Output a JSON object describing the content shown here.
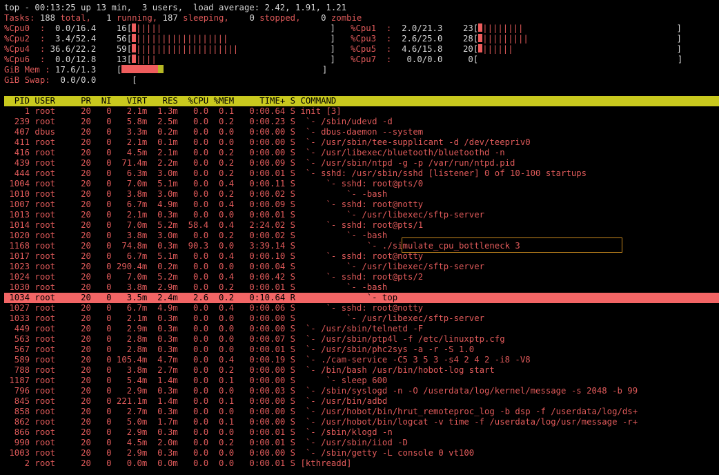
{
  "summary": {
    "line1": "top - 00:13:25 up 13 min,  3 users,  load average: 2.42, 1.91, 1.21",
    "tasks": {
      "label": "Tasks:",
      "total": "188",
      "total_word": " total,",
      "running": "1",
      "running_word": " running,",
      "sleeping": "187",
      "sleeping_word": " sleeping,",
      "stopped": "0",
      "stopped_word": " stopped,",
      "zombie": "0",
      "zombie_word": " zombie"
    }
  },
  "cpu_left": [
    {
      "label": "%Cpu0  :",
      "us_sy": "0.0/16.4",
      "pct": "16",
      "ticks": "|||||",
      "usage": 0.164
    },
    {
      "label": "%Cpu2  :",
      "us_sy": "3.4/52.4",
      "pct": "56",
      "ticks": "||||||||||||||||||",
      "usage": 0.558
    },
    {
      "label": "%Cpu4  :",
      "us_sy": "36.6/22.2",
      "pct": "59",
      "ticks": "||||||||||||||||||||",
      "usage": 0.588
    },
    {
      "label": "%Cpu6  :",
      "us_sy": "0.0/12.8",
      "pct": "13",
      "ticks": "||||",
      "usage": 0.128
    }
  ],
  "cpu_right": [
    {
      "label": "%Cpu1  :",
      "us_sy": "2.0/21.3",
      "pct": "23",
      "ticks": "||||||||",
      "usage": 0.233
    },
    {
      "label": "%Cpu3  :",
      "us_sy": "2.6/25.0",
      "pct": "28",
      "ticks": "|||||||||",
      "usage": 0.276
    },
    {
      "label": "%Cpu5  :",
      "us_sy": "4.6/15.8",
      "pct": "20",
      "ticks": "||||||",
      "usage": 0.204
    },
    {
      "label": "%Cpu7  :",
      "us_sy": "0.0/0.0",
      "pct": "0",
      "ticks": "",
      "usage": 0.0
    }
  ],
  "memory": {
    "mem_label": "GiB Mem :",
    "mem_values": "17.6/1.3",
    "mem_used_fraction": 0.105,
    "mem_buff_fraction": 0.014,
    "swap_label": "GiB Swap:",
    "swap_values": "0.0/0.0"
  },
  "columns": [
    "PID",
    "USER",
    "PR",
    "NI",
    "VIRT",
    "RES",
    "%CPU",
    "%MEM",
    "TIME+",
    "S",
    "COMMAND"
  ],
  "processes": [
    {
      "pid": "1",
      "user": "root",
      "pr": "20",
      "ni": "0",
      "virt": "2.1m",
      "res": "1.3m",
      "cpu": "0.0",
      "mem": "0.1",
      "time": "0:00.64",
      "s": "S",
      "cmd": "init [3]"
    },
    {
      "pid": "239",
      "user": "root",
      "pr": "20",
      "ni": "0",
      "virt": "5.8m",
      "res": "2.5m",
      "cpu": "0.0",
      "mem": "0.2",
      "time": "0:00.23",
      "s": "S",
      "cmd": " `- /sbin/udevd -d"
    },
    {
      "pid": "407",
      "user": "dbus",
      "pr": "20",
      "ni": "0",
      "virt": "3.3m",
      "res": "0.2m",
      "cpu": "0.0",
      "mem": "0.0",
      "time": "0:00.00",
      "s": "S",
      "cmd": " `- dbus-daemon --system"
    },
    {
      "pid": "411",
      "user": "root",
      "pr": "20",
      "ni": "0",
      "virt": "2.1m",
      "res": "0.1m",
      "cpu": "0.0",
      "mem": "0.0",
      "time": "0:00.00",
      "s": "S",
      "cmd": " `- /usr/sbin/tee-supplicant -d /dev/teepriv0"
    },
    {
      "pid": "416",
      "user": "root",
      "pr": "20",
      "ni": "0",
      "virt": "4.5m",
      "res": "2.1m",
      "cpu": "0.0",
      "mem": "0.2",
      "time": "0:00.00",
      "s": "S",
      "cmd": " `- /usr/libexec/bluetooth/bluetoothd -n"
    },
    {
      "pid": "439",
      "user": "root",
      "pr": "20",
      "ni": "0",
      "virt": "71.4m",
      "res": "2.2m",
      "cpu": "0.0",
      "mem": "0.2",
      "time": "0:00.09",
      "s": "S",
      "cmd": " `- /usr/sbin/ntpd -g -p /var/run/ntpd.pid"
    },
    {
      "pid": "444",
      "user": "root",
      "pr": "20",
      "ni": "0",
      "virt": "6.3m",
      "res": "3.0m",
      "cpu": "0.0",
      "mem": "0.2",
      "time": "0:00.01",
      "s": "S",
      "cmd": " `- sshd: /usr/sbin/sshd [listener] 0 of 10-100 startups"
    },
    {
      "pid": "1004",
      "user": "root",
      "pr": "20",
      "ni": "0",
      "virt": "7.0m",
      "res": "5.1m",
      "cpu": "0.0",
      "mem": "0.4",
      "time": "0:00.11",
      "s": "S",
      "cmd": "     `- sshd: root@pts/0"
    },
    {
      "pid": "1010",
      "user": "root",
      "pr": "20",
      "ni": "0",
      "virt": "3.8m",
      "res": "3.0m",
      "cpu": "0.0",
      "mem": "0.2",
      "time": "0:00.02",
      "s": "S",
      "cmd": "         `- -bash"
    },
    {
      "pid": "1007",
      "user": "root",
      "pr": "20",
      "ni": "0",
      "virt": "6.7m",
      "res": "4.9m",
      "cpu": "0.0",
      "mem": "0.4",
      "time": "0:00.09",
      "s": "S",
      "cmd": "     `- sshd: root@notty"
    },
    {
      "pid": "1013",
      "user": "root",
      "pr": "20",
      "ni": "0",
      "virt": "2.1m",
      "res": "0.3m",
      "cpu": "0.0",
      "mem": "0.0",
      "time": "0:00.01",
      "s": "S",
      "cmd": "         `- /usr/libexec/sftp-server"
    },
    {
      "pid": "1014",
      "user": "root",
      "pr": "20",
      "ni": "0",
      "virt": "7.0m",
      "res": "5.2m",
      "cpu": "58.4",
      "mem": "0.4",
      "time": "2:24.02",
      "s": "S",
      "cmd": "     `- sshd: root@pts/1"
    },
    {
      "pid": "1020",
      "user": "root",
      "pr": "20",
      "ni": "0",
      "virt": "3.8m",
      "res": "3.0m",
      "cpu": "0.0",
      "mem": "0.2",
      "time": "0:00.02",
      "s": "S",
      "cmd": "         `- -bash"
    },
    {
      "pid": "1168",
      "user": "root",
      "pr": "20",
      "ni": "0",
      "virt": "74.8m",
      "res": "0.3m",
      "cpu": "90.3",
      "mem": "0.0",
      "time": "3:39.14",
      "s": "S",
      "cmd": "             `- ./simulate_cpu_bottleneck 3"
    },
    {
      "pid": "1017",
      "user": "root",
      "pr": "20",
      "ni": "0",
      "virt": "6.7m",
      "res": "5.1m",
      "cpu": "0.0",
      "mem": "0.4",
      "time": "0:00.10",
      "s": "S",
      "cmd": "     `- sshd: root@notty"
    },
    {
      "pid": "1023",
      "user": "root",
      "pr": "20",
      "ni": "0",
      "virt": "290.4m",
      "res": "0.2m",
      "cpu": "0.0",
      "mem": "0.0",
      "time": "0:00.04",
      "s": "S",
      "cmd": "         `- /usr/libexec/sftp-server"
    },
    {
      "pid": "1024",
      "user": "root",
      "pr": "20",
      "ni": "0",
      "virt": "7.0m",
      "res": "5.2m",
      "cpu": "0.0",
      "mem": "0.4",
      "time": "0:00.42",
      "s": "S",
      "cmd": "     `- sshd: root@pts/2"
    },
    {
      "pid": "1030",
      "user": "root",
      "pr": "20",
      "ni": "0",
      "virt": "3.8m",
      "res": "2.9m",
      "cpu": "0.0",
      "mem": "0.2",
      "time": "0:00.01",
      "s": "S",
      "cmd": "         `- -bash"
    },
    {
      "pid": "1034",
      "user": "root",
      "pr": "20",
      "ni": "0",
      "virt": "3.5m",
      "res": "2.4m",
      "cpu": "2.6",
      "mem": "0.2",
      "time": "0:10.64",
      "s": "R",
      "cmd": "             `- top",
      "selected": true
    },
    {
      "pid": "1027",
      "user": "root",
      "pr": "20",
      "ni": "0",
      "virt": "6.7m",
      "res": "4.9m",
      "cpu": "0.0",
      "mem": "0.4",
      "time": "0:00.06",
      "s": "S",
      "cmd": "     `- sshd: root@notty"
    },
    {
      "pid": "1033",
      "user": "root",
      "pr": "20",
      "ni": "0",
      "virt": "2.1m",
      "res": "0.3m",
      "cpu": "0.0",
      "mem": "0.0",
      "time": "0:00.00",
      "s": "S",
      "cmd": "         `- /usr/libexec/sftp-server"
    },
    {
      "pid": "449",
      "user": "root",
      "pr": "20",
      "ni": "0",
      "virt": "2.9m",
      "res": "0.3m",
      "cpu": "0.0",
      "mem": "0.0",
      "time": "0:00.00",
      "s": "S",
      "cmd": " `- /usr/sbin/telnetd -F"
    },
    {
      "pid": "563",
      "user": "root",
      "pr": "20",
      "ni": "0",
      "virt": "2.8m",
      "res": "0.3m",
      "cpu": "0.0",
      "mem": "0.0",
      "time": "0:00.07",
      "s": "S",
      "cmd": " `- /usr/sbin/ptp4l -f /etc/linuxptp.cfg"
    },
    {
      "pid": "567",
      "user": "root",
      "pr": "20",
      "ni": "0",
      "virt": "2.8m",
      "res": "0.3m",
      "cpu": "0.0",
      "mem": "0.0",
      "time": "0:00.01",
      "s": "S",
      "cmd": " `- /usr/sbin/phc2sys -a -r -S 1.0"
    },
    {
      "pid": "589",
      "user": "root",
      "pr": "20",
      "ni": "0",
      "virt": "105.4m",
      "res": "4.7m",
      "cpu": "0.0",
      "mem": "0.4",
      "time": "0:00.19",
      "s": "S",
      "cmd": " `- ./cam-service -C5 3 5 3 -s4 2 4 2 -i8 -V8"
    },
    {
      "pid": "788",
      "user": "root",
      "pr": "20",
      "ni": "0",
      "virt": "3.8m",
      "res": "2.7m",
      "cpu": "0.0",
      "mem": "0.2",
      "time": "0:00.00",
      "s": "S",
      "cmd": " `- /bin/bash /usr/bin/hobot-log start"
    },
    {
      "pid": "1187",
      "user": "root",
      "pr": "20",
      "ni": "0",
      "virt": "5.4m",
      "res": "1.4m",
      "cpu": "0.0",
      "mem": "0.1",
      "time": "0:00.00",
      "s": "S",
      "cmd": "     `- sleep 600"
    },
    {
      "pid": "796",
      "user": "root",
      "pr": "20",
      "ni": "0",
      "virt": "2.9m",
      "res": "0.3m",
      "cpu": "0.0",
      "mem": "0.0",
      "time": "0:00.03",
      "s": "S",
      "cmd": " `- /sbin/syslogd -n -O /userdata/log/kernel/message -s 2048 -b 99"
    },
    {
      "pid": "845",
      "user": "root",
      "pr": "20",
      "ni": "0",
      "virt": "221.1m",
      "res": "1.4m",
      "cpu": "0.0",
      "mem": "0.1",
      "time": "0:00.00",
      "s": "S",
      "cmd": " `- /usr/bin/adbd"
    },
    {
      "pid": "858",
      "user": "root",
      "pr": "20",
      "ni": "0",
      "virt": "2.7m",
      "res": "0.3m",
      "cpu": "0.0",
      "mem": "0.0",
      "time": "0:00.00",
      "s": "S",
      "cmd": " `- /usr/hobot/bin/hrut_remoteproc_log -b dsp -f /userdata/log/ds+"
    },
    {
      "pid": "862",
      "user": "root",
      "pr": "20",
      "ni": "0",
      "virt": "5.0m",
      "res": "1.7m",
      "cpu": "0.0",
      "mem": "0.1",
      "time": "0:00.00",
      "s": "S",
      "cmd": " `- /usr/hobot/bin/logcat -v time -f /userdata/log/usr/message -r+"
    },
    {
      "pid": "866",
      "user": "root",
      "pr": "20",
      "ni": "0",
      "virt": "2.9m",
      "res": "0.3m",
      "cpu": "0.0",
      "mem": "0.0",
      "time": "0:00.01",
      "s": "S",
      "cmd": " `- /sbin/klogd -n"
    },
    {
      "pid": "990",
      "user": "root",
      "pr": "20",
      "ni": "0",
      "virt": "4.5m",
      "res": "2.0m",
      "cpu": "0.0",
      "mem": "0.2",
      "time": "0:00.01",
      "s": "S",
      "cmd": " `- /usr/sbin/iiod -D"
    },
    {
      "pid": "1003",
      "user": "root",
      "pr": "20",
      "ni": "0",
      "virt": "2.9m",
      "res": "0.3m",
      "cpu": "0.0",
      "mem": "0.0",
      "time": "0:00.00",
      "s": "S",
      "cmd": " `- /sbin/getty -L console 0 vt100"
    },
    {
      "pid": "2",
      "user": "root",
      "pr": "20",
      "ni": "0",
      "virt": "0.0m",
      "res": "0.0m",
      "cpu": "0.0",
      "mem": "0.0",
      "time": "0:00.01",
      "s": "S",
      "cmd": "[kthreadd]"
    }
  ],
  "colors": {
    "background": "#000000",
    "text": "#d6d6d6",
    "accent_red": "#e05a5a",
    "header_bar": "#c9c91e",
    "selected_row": "#f26565",
    "mem_buffer": "#b7b825",
    "highlight_box": "#c98a1f"
  }
}
